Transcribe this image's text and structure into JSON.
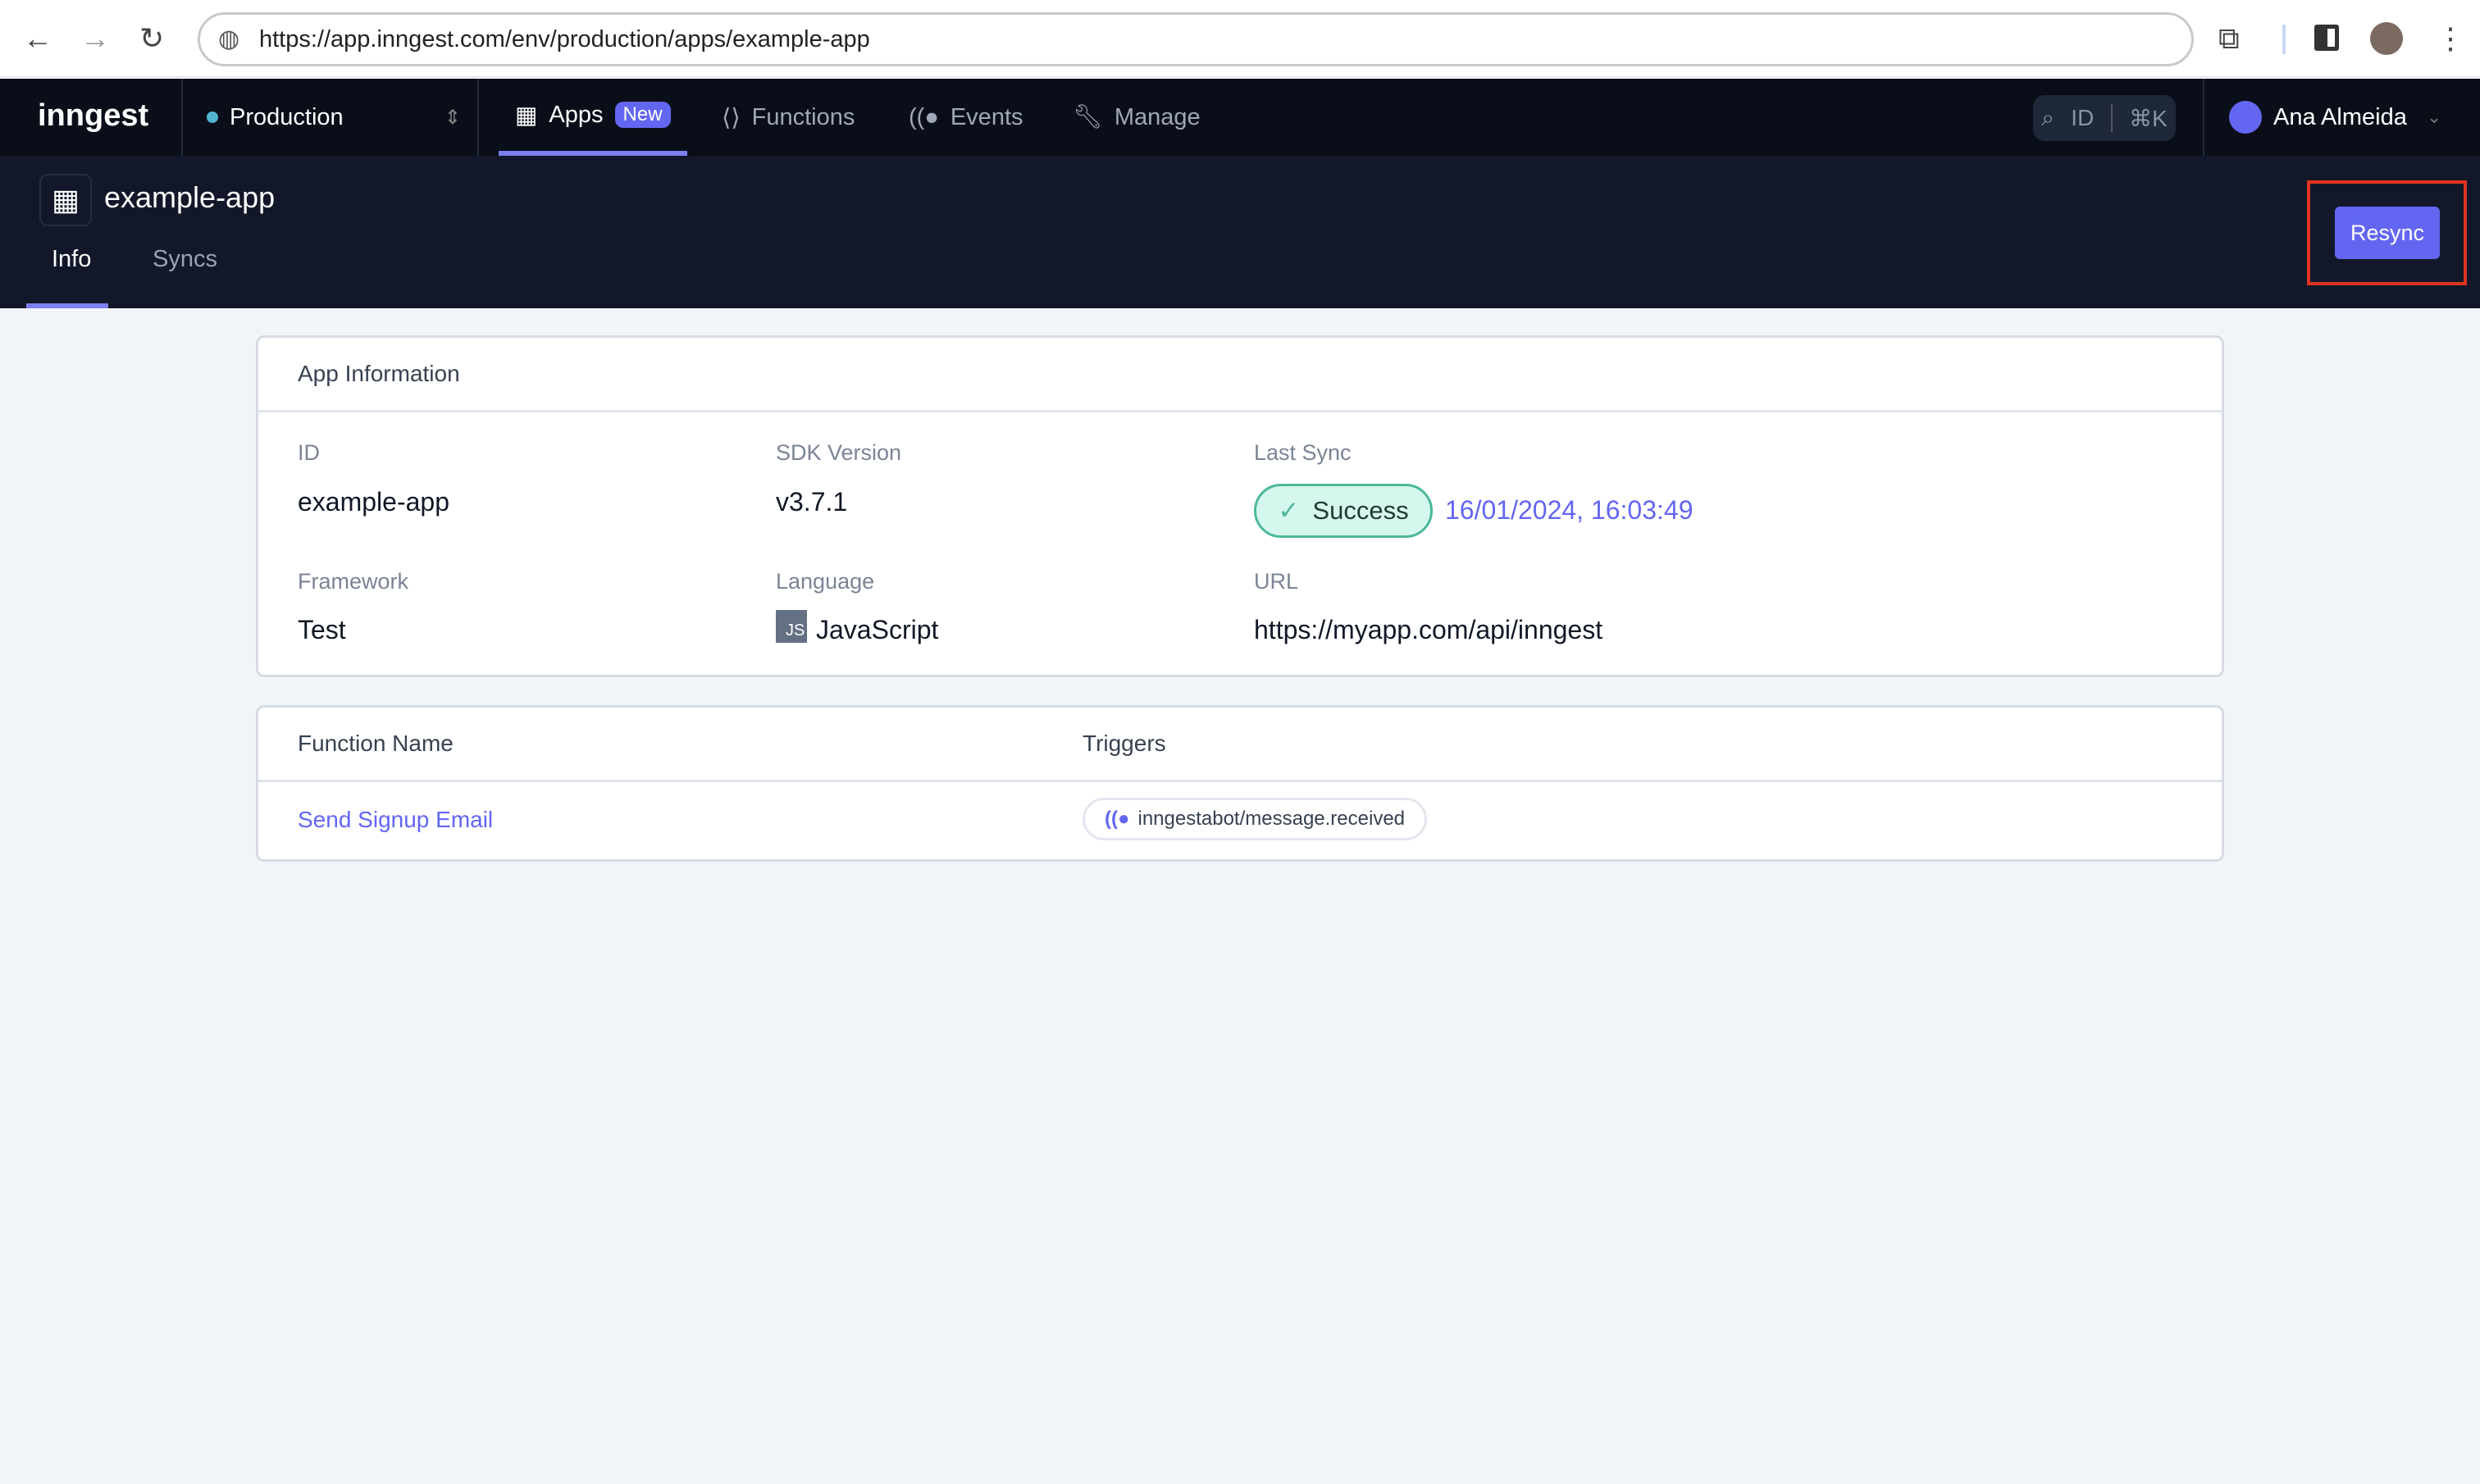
{
  "browser": {
    "url": "https://app.inngest.com/env/production/apps/example-app"
  },
  "nav": {
    "logo": "inngest",
    "environment": "Production",
    "items": [
      {
        "label": "Apps",
        "badge": "New",
        "icon": "apps-grid-icon"
      },
      {
        "label": "Functions",
        "icon": "function-icon"
      },
      {
        "label": "Events",
        "icon": "events-icon"
      },
      {
        "label": "Manage",
        "icon": "wrench-icon"
      }
    ],
    "search_id": "ID",
    "shortcut": "⌘K",
    "user": "Ana Almeida"
  },
  "header": {
    "title": "example-app",
    "tabs": [
      "Info",
      "Syncs"
    ],
    "resync": "Resync"
  },
  "app_info": {
    "title": "App Information",
    "fields": {
      "id_label": "ID",
      "id": "example-app",
      "sdk_label": "SDK Version",
      "sdk": "v3.7.1",
      "sync_label": "Last Sync",
      "sync_status": "Success",
      "sync_time": "16/01/2024, 16:03:49",
      "framework_label": "Framework",
      "framework": "Test",
      "language_label": "Language",
      "language_badge": "JS",
      "language": "JavaScript",
      "url_label": "URL",
      "url": "https://myapp.com/api/inngest"
    }
  },
  "functions": {
    "headers": [
      "Function Name",
      "Triggers"
    ],
    "rows": [
      {
        "name": "Send Signup Email",
        "trigger": "inngestabot/message.received"
      }
    ]
  },
  "colors": {
    "accent": "#6366f1",
    "success_bg": "#d5f7ee",
    "success_border": "#4cb89a"
  }
}
